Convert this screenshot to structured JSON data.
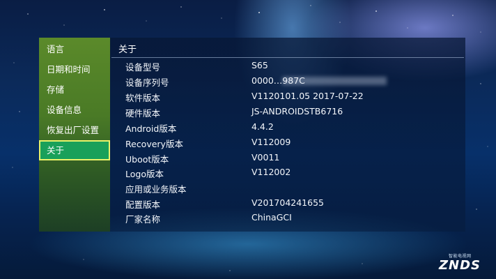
{
  "sidebar": {
    "items": [
      {
        "label": "语言"
      },
      {
        "label": "日期和时间"
      },
      {
        "label": "存储"
      },
      {
        "label": "设备信息"
      },
      {
        "label": "恢复出厂设置"
      },
      {
        "label": "关于",
        "selected": true
      }
    ]
  },
  "header": {
    "title": "关于"
  },
  "info": {
    "rows": [
      {
        "label": "设备型号",
        "value": "S65"
      },
      {
        "label": "设备序列号",
        "value": "0000…987C",
        "partially_obscured": true
      },
      {
        "label": "软件版本",
        "value": "V1120101.05 2017-07-22"
      },
      {
        "label": "硬件版本",
        "value": "JS-ANDROIDSTB6716"
      },
      {
        "label": "Android版本",
        "value": "4.4.2"
      },
      {
        "label": "Recovery版本",
        "value": "V112009"
      },
      {
        "label": "Uboot版本",
        "value": "V0011"
      },
      {
        "label": "Logo版本",
        "value": "V112002"
      },
      {
        "label": "应用或业务版本",
        "value": ""
      },
      {
        "label": "配置版本",
        "value": "V201704241655"
      },
      {
        "label": "厂家名称",
        "value": "ChinaGCI"
      }
    ]
  },
  "watermark": {
    "brand": "ZNDS",
    "tagline": "智能电视网"
  },
  "colors": {
    "sidebar_green": "#4a7a26",
    "selected_fill": "#19a05a",
    "selected_border": "#e9f36a",
    "background_blue": "#0b2a5a"
  }
}
